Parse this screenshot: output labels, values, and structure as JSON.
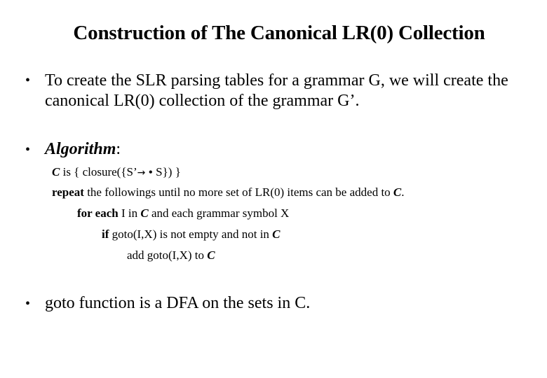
{
  "slide": {
    "title": "Construction of The Canonical LR(0) Collection",
    "bullets": [
      {
        "bullet_glyph": "•",
        "line1": "To create the SLR parsing tables for a grammar G, we will create the",
        "line2": "canonical LR(0) collection of the grammar G’."
      },
      {
        "bullet_glyph": "•",
        "heading": "Algorithm",
        "heading_suffix": ":"
      },
      {
        "bullet_glyph": "•",
        "line1": "goto function is a DFA on the sets in C."
      }
    ],
    "algorithm": {
      "line1": {
        "var": "C",
        "text_a": " is { closure({S’",
        "arrow": "→",
        "dot": "•",
        "text_b": " S}) }"
      },
      "line2": {
        "keyword": "repeat",
        "text": " the followings until no more set of LR(0) items can be added to ",
        "var": "C",
        "end": "."
      },
      "line3": {
        "keyword": "for each",
        "text_a": " I in ",
        "var": "C",
        "text_b": " and each grammar symbol X"
      },
      "line4": {
        "keyword": "if",
        "text": " goto(I,X) is not empty and not in ",
        "var": "C"
      },
      "line5": {
        "text": "add goto(I,X) to ",
        "var": "C"
      }
    }
  }
}
